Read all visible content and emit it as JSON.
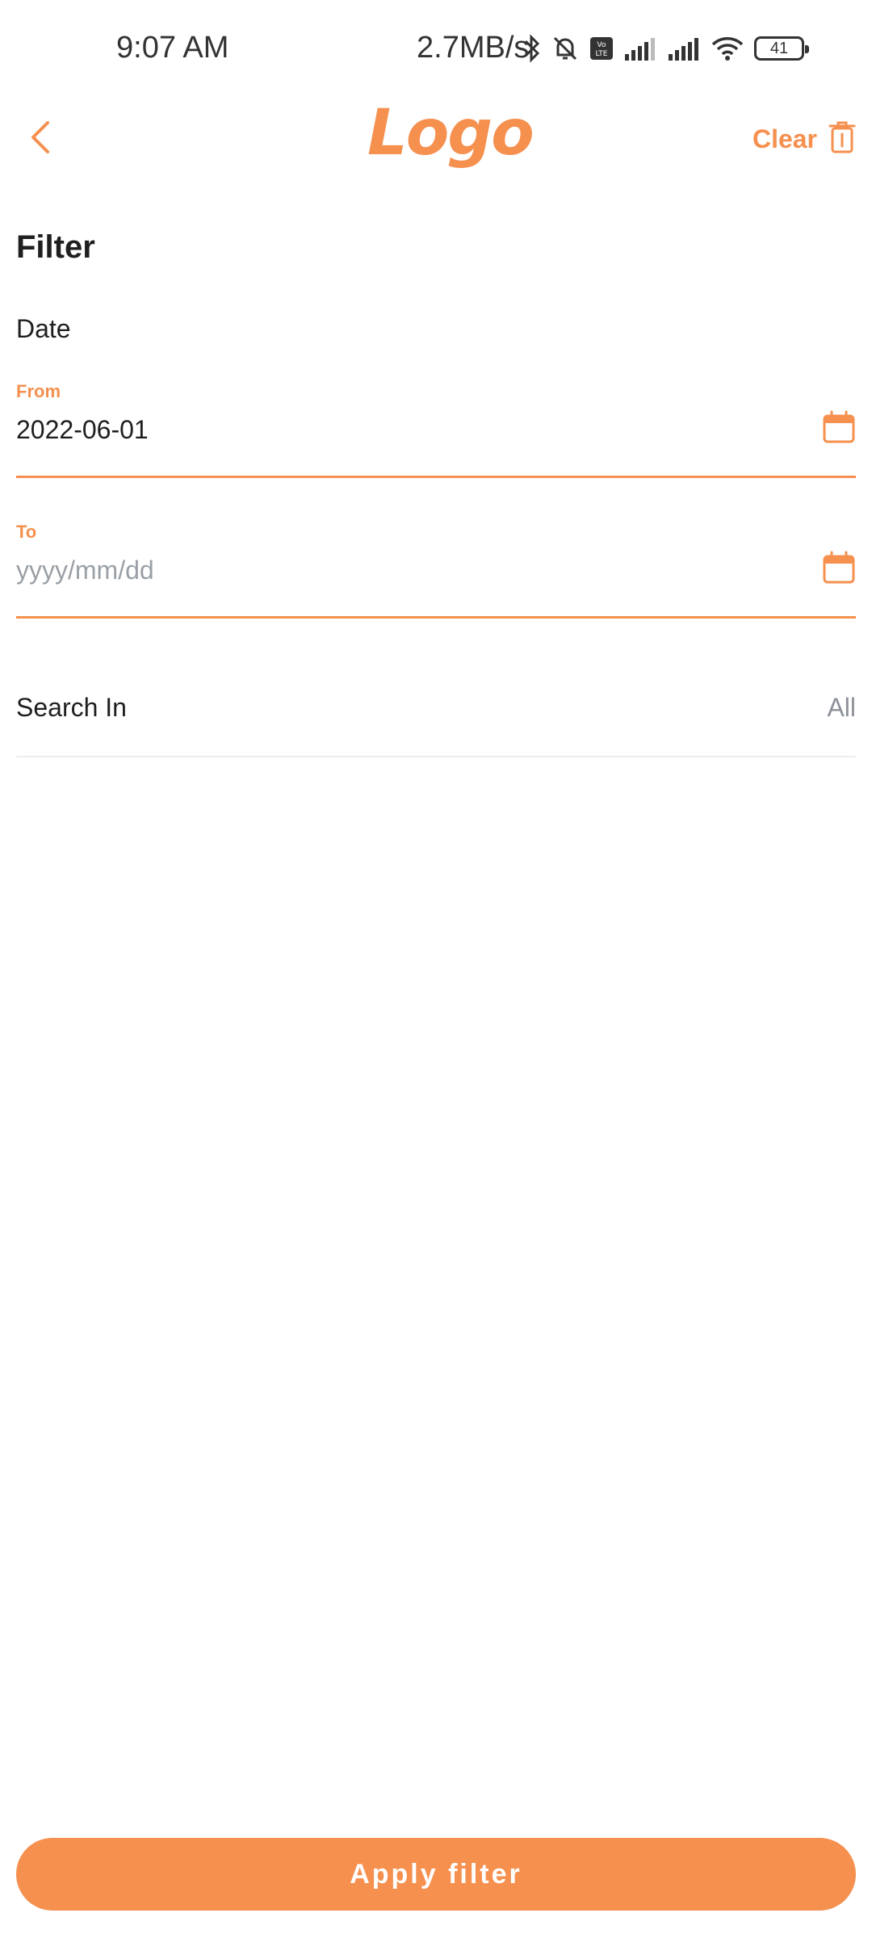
{
  "status_bar": {
    "time": "9:07 AM",
    "speed": "2.7MB/s",
    "battery": "41"
  },
  "header": {
    "logo_text": "Logo",
    "clear_label": "Clear"
  },
  "page": {
    "title": "Filter",
    "date_section": "Date"
  },
  "fields": {
    "from": {
      "label": "From",
      "value": "2022-06-01",
      "placeholder": "yyyy/mm/dd"
    },
    "to": {
      "label": "To",
      "value": "",
      "placeholder": "yyyy/mm/dd"
    }
  },
  "search_in": {
    "label": "Search In",
    "value": "All"
  },
  "apply_button": {
    "label": "Apply filter"
  },
  "colors": {
    "accent": "#f5904f",
    "text": "#1f1f1f",
    "muted": "#8d9199"
  }
}
